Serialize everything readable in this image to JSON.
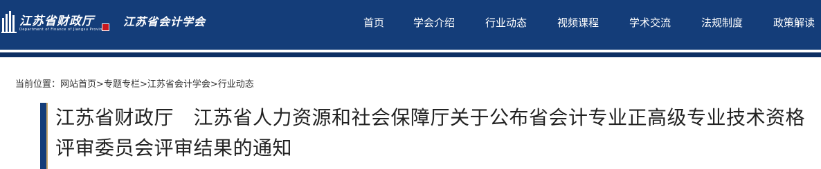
{
  "header": {
    "logo": {
      "finance_name": "江苏省财政厅",
      "finance_name_en": "Department of Finance of Jiangsu Province",
      "society_name": "江苏省会计学会"
    },
    "nav": [
      {
        "label": "首页"
      },
      {
        "label": "学会介绍"
      },
      {
        "label": "行业动态"
      },
      {
        "label": "视频课程"
      },
      {
        "label": "学术交流"
      },
      {
        "label": "法规制度"
      },
      {
        "label": "政策解读"
      }
    ],
    "colors": {
      "bar": "#143d79",
      "accent": "#c8171d"
    }
  },
  "breadcrumb": {
    "prefix": "当前位置：",
    "items": [
      "网站首页",
      "专题专栏",
      "江苏省会计学会",
      "行业动态"
    ],
    "separator": ">"
  },
  "article": {
    "title": "江苏省财政厅　江苏省人力资源和社会保障厅关于公布省会计专业正高级专业技术资格评审委员会评审结果的通知"
  }
}
